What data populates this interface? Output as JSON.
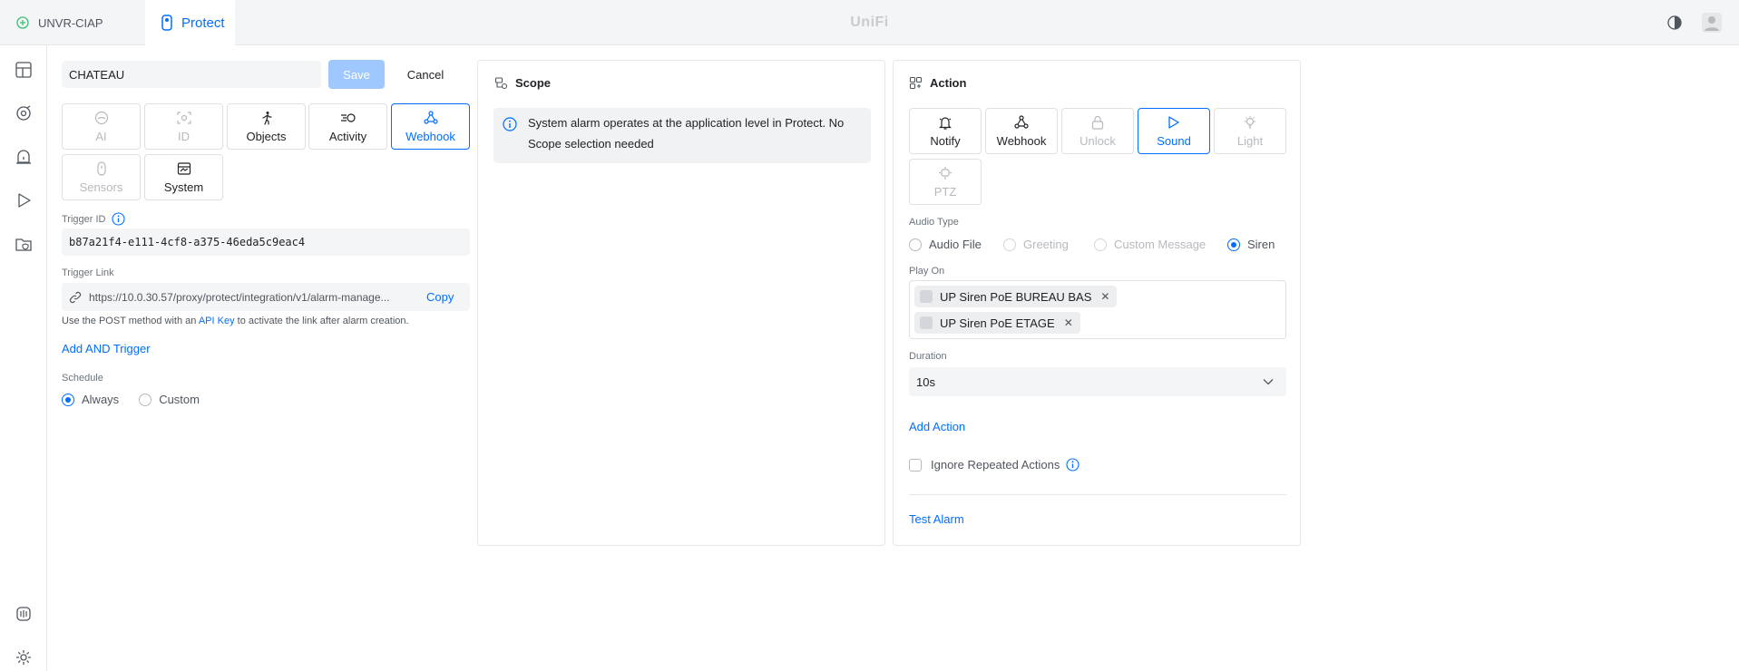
{
  "topbar": {
    "console_name": "UNVR-CIAP",
    "app_name": "Protect",
    "brand": "UniFi"
  },
  "alarm": {
    "name_value": "CHATEAU",
    "save_label": "Save",
    "cancel_label": "Cancel"
  },
  "trigger_types": [
    {
      "label": "AI",
      "icon": "ai-icon",
      "state": "disabled"
    },
    {
      "label": "ID",
      "icon": "face-id-icon",
      "state": "disabled"
    },
    {
      "label": "Objects",
      "icon": "person-running-icon",
      "state": "normal"
    },
    {
      "label": "Activity",
      "icon": "motion-icon",
      "state": "normal"
    },
    {
      "label": "Webhook",
      "icon": "webhook-icon",
      "state": "selected"
    },
    {
      "label": "Sensors",
      "icon": "sensor-icon",
      "state": "disabled"
    },
    {
      "label": "System",
      "icon": "system-icon",
      "state": "normal"
    }
  ],
  "trigger_id": {
    "label": "Trigger ID",
    "value": "b87a21f4-e111-4cf8-a375-46eda5c9eac4"
  },
  "trigger_link": {
    "label": "Trigger Link",
    "url": "https://10.0.30.57/proxy/protect/integration/v1/alarm-manage...",
    "copy_label": "Copy",
    "help_prefix": "Use the POST method with an ",
    "help_link": "API Key",
    "help_suffix": " to activate the link after alarm creation."
  },
  "add_and_trigger_label": "Add AND Trigger",
  "schedule": {
    "label": "Schedule",
    "options": [
      {
        "label": "Always",
        "selected": true
      },
      {
        "label": "Custom",
        "selected": false
      }
    ]
  },
  "scope": {
    "title": "Scope",
    "info_text": "System alarm operates at the application level in Protect. No Scope selection needed"
  },
  "action": {
    "title": "Action",
    "types": [
      {
        "label": "Notify",
        "icon": "bell-icon",
        "state": "normal"
      },
      {
        "label": "Webhook",
        "icon": "webhook-icon",
        "state": "normal"
      },
      {
        "label": "Unlock",
        "icon": "lock-icon",
        "state": "disabled"
      },
      {
        "label": "Sound",
        "icon": "play-icon",
        "state": "selected"
      },
      {
        "label": "Light",
        "icon": "bulb-icon",
        "state": "disabled"
      },
      {
        "label": "PTZ",
        "icon": "ptz-icon",
        "state": "disabled"
      }
    ],
    "audio_type": {
      "label": "Audio Type",
      "options": [
        {
          "label": "Audio File",
          "selected": false,
          "disabled": false
        },
        {
          "label": "Greeting",
          "selected": false,
          "disabled": true
        },
        {
          "label": "Custom Message",
          "selected": false,
          "disabled": true
        },
        {
          "label": "Siren",
          "selected": true,
          "disabled": false
        }
      ]
    },
    "play_on": {
      "label": "Play On",
      "devices": [
        "UP Siren PoE BUREAU BAS",
        "UP Siren PoE ETAGE"
      ]
    },
    "duration": {
      "label": "Duration",
      "value": "10s"
    },
    "add_action_label": "Add Action",
    "ignore_repeated_label": "Ignore Repeated Actions",
    "test_alarm_label": "Test Alarm"
  },
  "colors": {
    "accent": "#006fff",
    "disabled": "#b6b9be",
    "field_bg": "#f4f5f6"
  }
}
